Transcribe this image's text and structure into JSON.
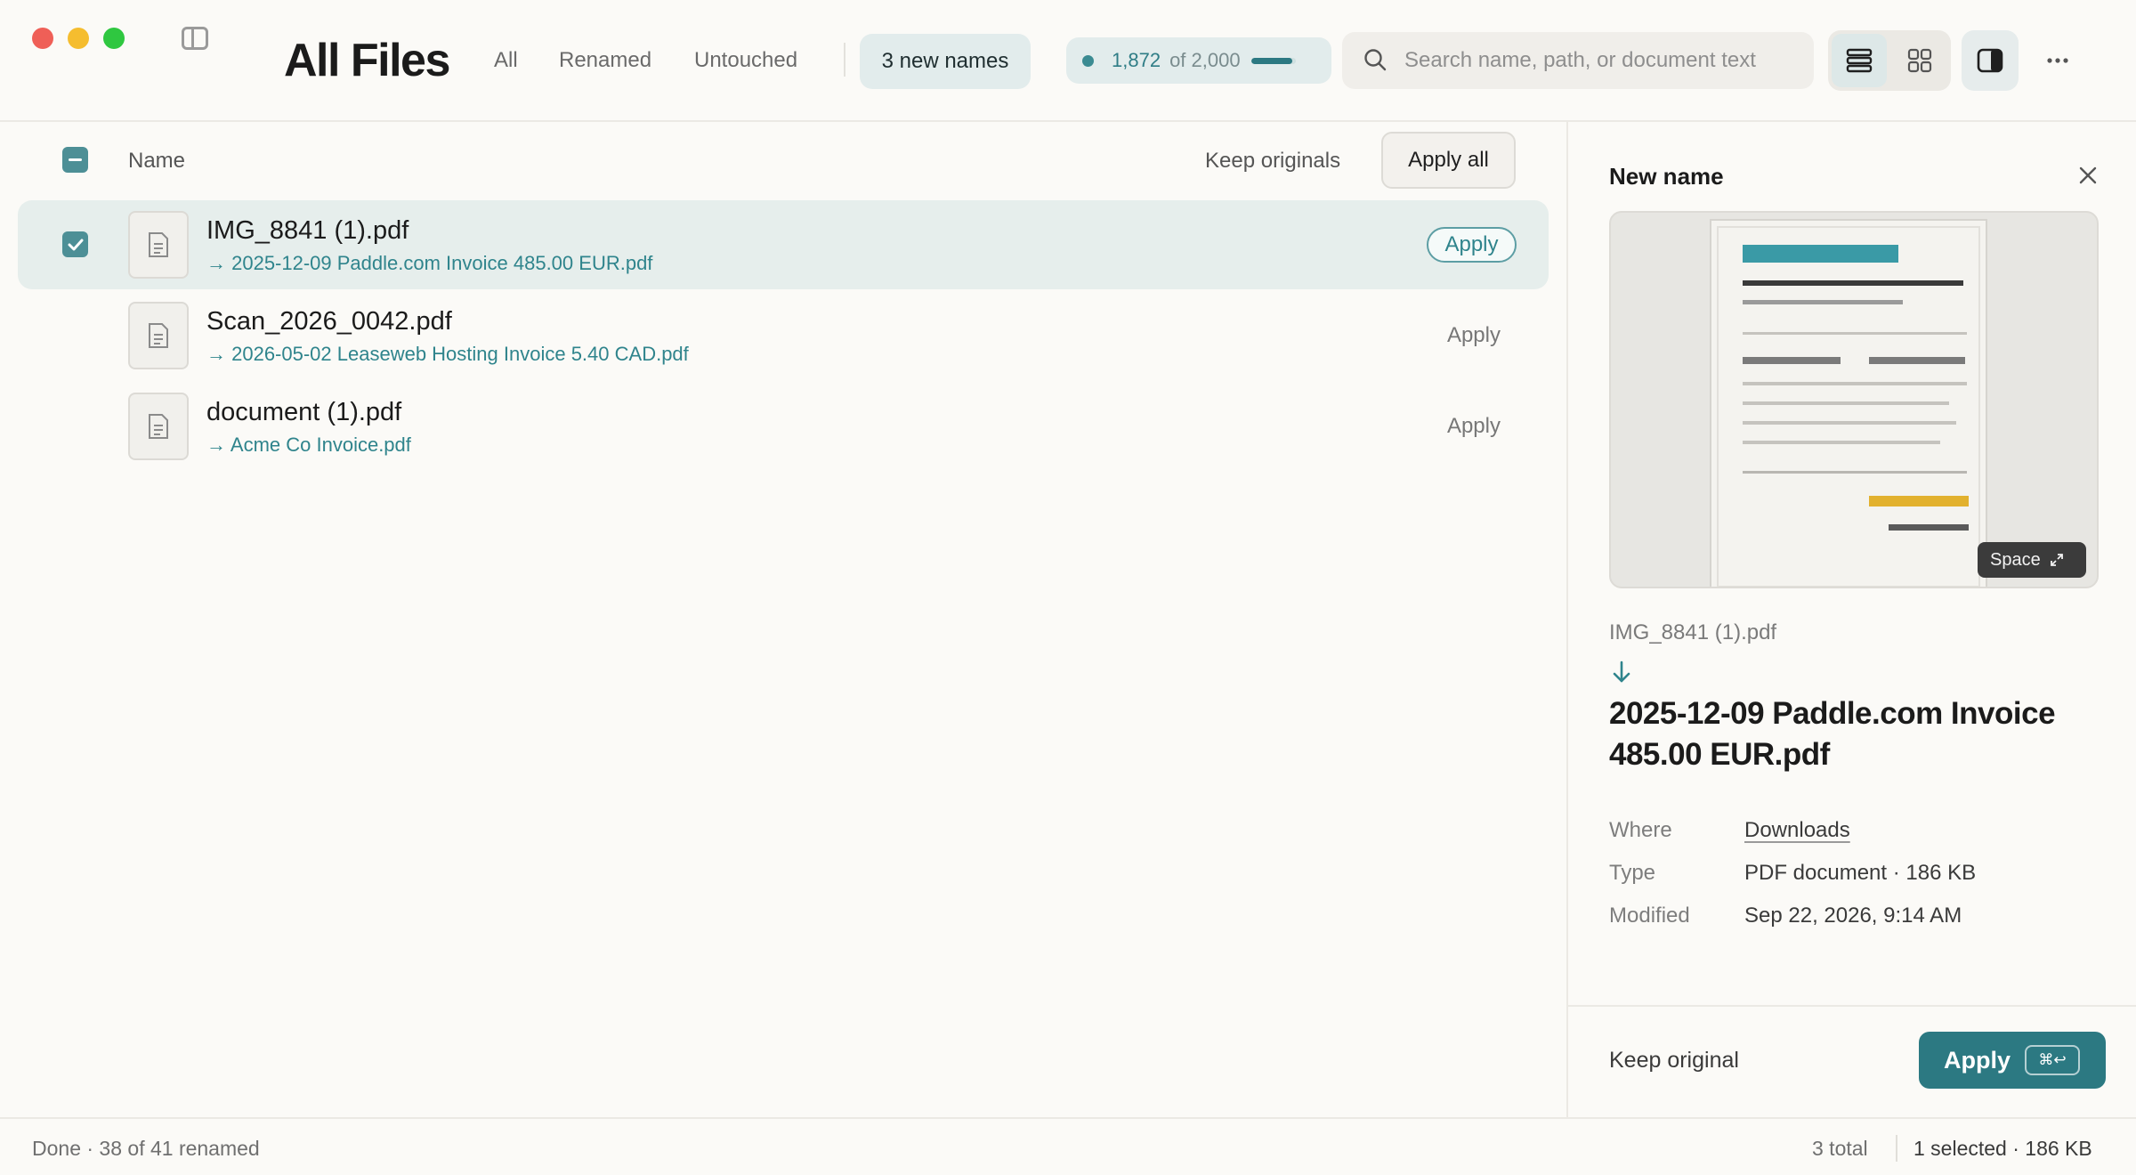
{
  "toolbar": {
    "title": "All Files",
    "filters": [
      "All",
      "Renamed",
      "Untouched"
    ],
    "new_names_label": "3 new names",
    "usage": {
      "count": "1,872",
      "of": "of 2,000",
      "fraction": 0.936
    },
    "search": {
      "placeholder": "Search name, path, or document text"
    },
    "view_mode": "list"
  },
  "list": {
    "header": {
      "name_label": "Name",
      "keep_originals": "Keep originals",
      "apply_all": "Apply all"
    },
    "rows": [
      {
        "name": "IMG_8841 (1).pdf",
        "new_name": "→ 2025-12-09 Paddle.com Invoice 485.00 EUR.pdf",
        "apply": "Apply",
        "selected": true
      },
      {
        "name": "Scan_2026_0042.pdf",
        "new_name": "→ 2026-05-02 Leaseweb Hosting Invoice 5.40 CAD.pdf",
        "apply": "Apply",
        "selected": false
      },
      {
        "name": "document (1).pdf",
        "new_name": "→ Acme Co Invoice.pdf",
        "apply": "Apply",
        "selected": false
      }
    ]
  },
  "inspector": {
    "title": "New name",
    "space_hint": "Space",
    "old_name": "IMG_8841 (1).pdf",
    "new_name": "2025-12-09 Paddle.com Invoice 485.00 EUR.pdf",
    "meta": {
      "where_label": "Where",
      "where_value": "Downloads",
      "type_label": "Type",
      "type_value": "PDF document · 186 KB",
      "modified_label": "Modified",
      "modified_value": "Sep 22, 2026, 9:14 AM"
    },
    "keep_original": "Keep original",
    "apply_label": "Apply",
    "apply_shortcut": "⌘↩"
  },
  "status": {
    "left": "Done · 38 of 41 renamed",
    "total": "3 total",
    "selected": "1 selected · 186 KB"
  },
  "colors": {
    "accent": "#2c7982",
    "link": "#2f848c",
    "selected_row": "#e6eeec",
    "doc_highlight": "#3a9aa6",
    "doc_total": "#e2b12e"
  }
}
